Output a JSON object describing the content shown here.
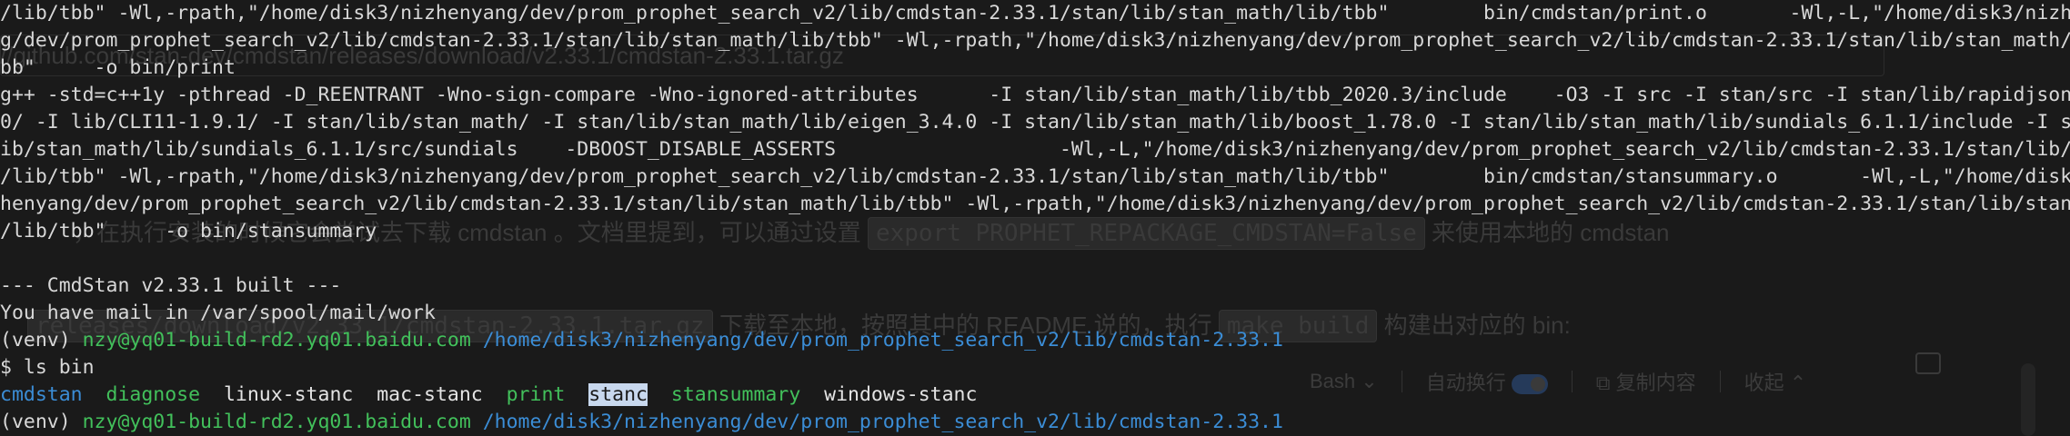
{
  "ghost": {
    "url_text": "//github.com/stan-dev/cmdstan/releases/download/v2.33.1/cmdstan-2.33.1.tar.gz",
    "para1_prefix": "，在执行安装的时候它会尝试去下载 cmdstan 。文档里提到，可以通过设置",
    "para1_code": "export PROPHET_REPACKAGE_CMDSTAN=False",
    "para1_suffix": "来使用本地的 cmdstan",
    "para2_prefix": "releases/download/v2.33.1/cmdstan-2.33.1.tar.gz",
    "para2_middle": "下载至本地，按照其中的 README 说的，执行",
    "para2_code": "make build",
    "para2_suffix": "构建出对应的 bin:",
    "toolbar": {
      "language": "Bash",
      "wrap_label": "自动换行",
      "copy_label": "复制内容",
      "collapse_label": "收起"
    }
  },
  "terminal": {
    "lines": [
      "/lib/tbb\" -Wl,-rpath,\"/home/disk3/nizhenyang/dev/prom_prophet_search_v2/lib/cmdstan-2.33.1/stan/lib/stan_math/lib/tbb\"        bin/cmdstan/print.o       -Wl,-L,\"/home/disk3/nizhenyan",
      "g/dev/prom_prophet_search_v2/lib/cmdstan-2.33.1/stan/lib/stan_math/lib/tbb\" -Wl,-rpath,\"/home/disk3/nizhenyang/dev/prom_prophet_search_v2/lib/cmdstan-2.33.1/stan/lib/stan_math/lib/t",
      "bb\"     -o bin/print",
      "g++ -std=c++1y -pthread -D_REENTRANT -Wno-sign-compare -Wno-ignored-attributes      -I stan/lib/stan_math/lib/tbb_2020.3/include    -O3 -I src -I stan/src -I stan/lib/rapidjson_1.1.",
      "0/ -I lib/CLI11-1.9.1/ -I stan/lib/stan_math/ -I stan/lib/stan_math/lib/eigen_3.4.0 -I stan/lib/stan_math/lib/boost_1.78.0 -I stan/lib/stan_math/lib/sundials_6.1.1/include -I stan/l",
      "ib/stan_math/lib/sundials_6.1.1/src/sundials    -DBOOST_DISABLE_ASSERTS                   -Wl,-L,\"/home/disk3/nizhenyang/dev/prom_prophet_search_v2/lib/cmdstan-2.33.1/stan/lib/stan_math",
      "/lib/tbb\" -Wl,-rpath,\"/home/disk3/nizhenyang/dev/prom_prophet_search_v2/lib/cmdstan-2.33.1/stan/lib/stan_math/lib/tbb\"        bin/cmdstan/stansummary.o       -Wl,-L,\"/home/disk3/niz",
      "henyang/dev/prom_prophet_search_v2/lib/cmdstan-2.33.1/stan/lib/stan_math/lib/tbb\" -Wl,-rpath,\"/home/disk3/nizhenyang/dev/prom_prophet_search_v2/lib/cmdstan-2.33.1/stan/lib/stan_math",
      "/lib/tbb\"     -o bin/stansummary",
      "",
      "--- CmdStan v2.33.1 built ---",
      "You have mail in /var/spool/mail/work"
    ],
    "prompt1": {
      "venv": "(venv) ",
      "host": "nzy@yq01-build-rd2.yq01.baidu.com",
      "path": " /home/disk3/nizhenyang/dev/prom_prophet_search_v2/lib/cmdstan-2.33.1"
    },
    "command": "$ ls bin",
    "ls_output": [
      {
        "name": "cmdstan",
        "color": "#3b8dd6"
      },
      {
        "name": "diagnose",
        "color": "#42c05b"
      },
      {
        "name": "linux-stanc",
        "color": "#e4e4e4"
      },
      {
        "name": "mac-stanc",
        "color": "#e4e4e4"
      },
      {
        "name": "print",
        "color": "#42c05b"
      },
      {
        "name": "stanc",
        "color": "#1a1a1a",
        "selected": true
      },
      {
        "name": "stansummary",
        "color": "#42c05b"
      },
      {
        "name": "windows-stanc",
        "color": "#e4e4e4"
      }
    ],
    "prompt2": {
      "venv": "(venv) ",
      "host": "nzy@yq01-build-rd2.yq01.baidu.com",
      "path": " /home/disk3/nizhenyang/dev/prom_prophet_search_v2/lib/cmdstan-2.33.1"
    },
    "colors": {
      "background": "#1a1a1a",
      "text": "#d8d8d8",
      "host_green": "#42c05b",
      "path_blue": "#3b8dd6",
      "selection": "#c8d8ee"
    }
  }
}
